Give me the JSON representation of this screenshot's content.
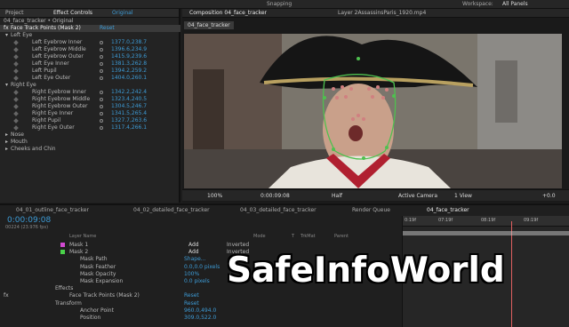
{
  "topbar": {
    "snapping": "Snapping",
    "workspace_label": "Workspace:",
    "workspace_value": "All Panels"
  },
  "effect_panel": {
    "tabs": [
      "Project",
      "Effect Controls",
      "Original"
    ],
    "breadcrumb": "04_face_tracker • Original",
    "effect_name": "Face Track Points (Mask 2)",
    "reset": "Reset",
    "groups": [
      {
        "name": "Left Eye",
        "items": [
          {
            "label": "Left Eyebrow Inner",
            "value": "1377.0,238.7"
          },
          {
            "label": "Left Eyebrow Middle",
            "value": "1396.6,234.9"
          },
          {
            "label": "Left Eyebrow Outer",
            "value": "1415.9,239.6"
          },
          {
            "label": "Left Eye Inner",
            "value": "1381.3,262.8"
          },
          {
            "label": "Left Pupil",
            "value": "1394.2,259.2"
          },
          {
            "label": "Left Eye Outer",
            "value": "1404.0,260.1"
          }
        ]
      },
      {
        "name": "Right Eye",
        "items": [
          {
            "label": "Right Eyebrow Inner",
            "value": "1342.2,242.4"
          },
          {
            "label": "Right Eyebrow Middle",
            "value": "1323.4,240.5"
          },
          {
            "label": "Right Eyebrow Outer",
            "value": "1304.5,246.7"
          },
          {
            "label": "Right Eye Inner",
            "value": "1341.5,265.4"
          },
          {
            "label": "Right Pupil",
            "value": "1327.7,263.6"
          },
          {
            "label": "Right Eye Outer",
            "value": "1317.4,266.1"
          }
        ]
      }
    ],
    "collapsed": [
      "Nose",
      "Mouth",
      "Cheeks and Chin"
    ]
  },
  "comp_panel": {
    "tab_title": "Composition 04_face_tracker",
    "layer_tab": "Layer 2AssassinsParis_1920.mp4",
    "subtab": "04_face_tracker",
    "viewbar": {
      "zoom": "100%",
      "timecode": "0:00:09:08",
      "resolution": "Half",
      "camera": "Active Camera",
      "views": "1 View",
      "exposure": "+0.0"
    }
  },
  "timeline": {
    "tabs": [
      "04_01_outline_face_tracker",
      "04_02_detailed_face_tracker",
      "04_03_detailed_face_tracker",
      "Render Queue",
      "04_face_tracker"
    ],
    "timecode": "0:00:09:08",
    "frames": "00224 (23.976 fps)",
    "headers": {
      "layer_name": "Layer Name",
      "mode": "Mode",
      "t": "T",
      "trkmat": "TrkMat",
      "parent": "Parent"
    },
    "rows": [
      {
        "indent": 0,
        "label": "Mask 1",
        "mode": "Add",
        "extra": "Inverted",
        "color": "#d24ad2"
      },
      {
        "indent": 0,
        "label": "Mask 2",
        "mode": "Add",
        "extra": "Inverted",
        "color": "#4ad24a"
      },
      {
        "indent": 1,
        "label": "Mask Path",
        "value": "Shape..."
      },
      {
        "indent": 1,
        "label": "Mask Feather",
        "value": "0.0,0.0 pixels"
      },
      {
        "indent": 1,
        "label": "Mask Opacity",
        "value": "100%"
      },
      {
        "indent": 1,
        "label": "Mask Expansion",
        "value": "0.0 pixels"
      },
      {
        "indent": -1,
        "label": "Effects",
        "value": ""
      },
      {
        "indent": 0,
        "label": "Face Track Points (Mask 2)",
        "value": "Reset",
        "fx": "fx"
      },
      {
        "indent": -1,
        "label": "Transform",
        "value": "Reset"
      },
      {
        "indent": 1,
        "label": "Anchor Point",
        "value": "960.0,494.0"
      },
      {
        "indent": 1,
        "label": "Position",
        "value": "309.0,522.0"
      }
    ],
    "ruler": [
      "0:19f",
      "07:19f",
      "08:19f",
      "09:19f"
    ]
  },
  "watermark": "SafeInfoWorld"
}
